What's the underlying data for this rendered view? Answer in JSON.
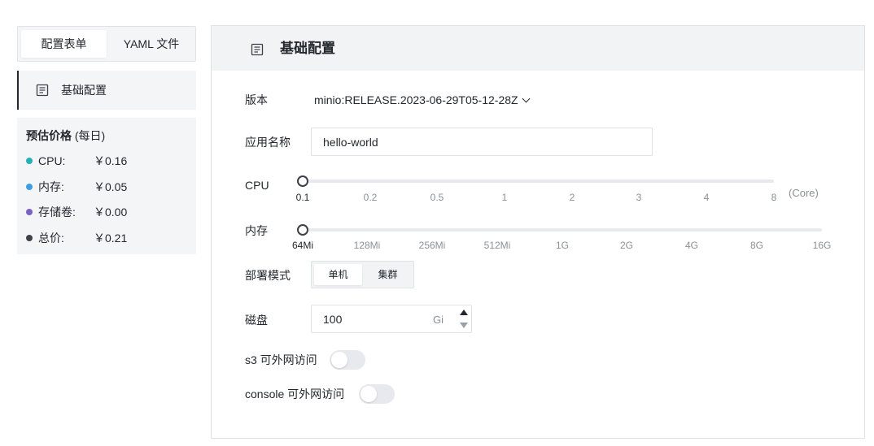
{
  "mode_tabs": [
    {
      "label": "配置表单",
      "active": true
    },
    {
      "label": "YAML 文件",
      "active": false
    }
  ],
  "sidebar": {
    "nav_item": {
      "label": "基础配置",
      "icon": "document-icon"
    }
  },
  "price": {
    "title": "预估价格",
    "period": "(每日)",
    "rows": [
      {
        "label": "CPU:",
        "value": "￥0.16",
        "color": "#26b0b3"
      },
      {
        "label": "内存:",
        "value": "￥0.05",
        "color": "#3e9de0"
      },
      {
        "label": "存储卷:",
        "value": "￥0.00",
        "color": "#7b5fc4"
      },
      {
        "label": "总价:",
        "value": "￥0.21",
        "color": "#3c4148"
      }
    ]
  },
  "panel": {
    "title": "基础配置",
    "icon": "document-icon"
  },
  "form": {
    "version": {
      "label": "版本",
      "value": "minio:RELEASE.2023-06-29T05-12-28Z"
    },
    "app_name": {
      "label": "应用名称",
      "value": "hello-world"
    },
    "cpu": {
      "label": "CPU",
      "unit": "(Core)",
      "ticks": [
        "0.1",
        "0.2",
        "0.5",
        "1",
        "2",
        "3",
        "4",
        "8"
      ],
      "value": "0.1"
    },
    "memory": {
      "label": "内存",
      "ticks": [
        "64Mi",
        "128Mi",
        "256Mi",
        "512Mi",
        "1G",
        "2G",
        "4G",
        "8G",
        "16G"
      ],
      "value": "64Mi"
    },
    "deploy_mode": {
      "label": "部署模式",
      "options": [
        "单机",
        "集群"
      ],
      "selected": "单机"
    },
    "disk": {
      "label": "磁盘",
      "value": "100",
      "unit": "Gi"
    },
    "s3_public": {
      "label": "s3 可外网访问",
      "enabled": false
    },
    "console_public": {
      "label": "console 可外网访问",
      "enabled": false
    }
  }
}
